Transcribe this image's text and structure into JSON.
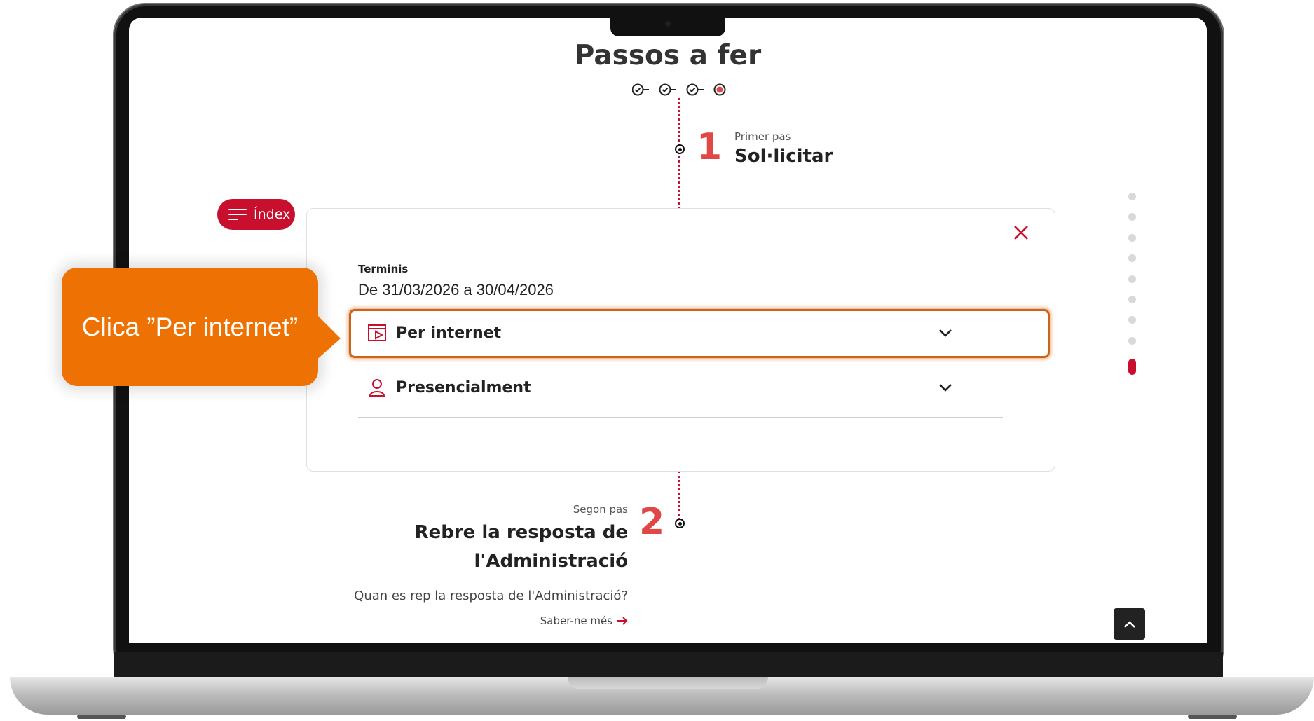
{
  "page": {
    "title": "Passos a fer",
    "steps_progress": [
      "done",
      "done",
      "done",
      "current"
    ]
  },
  "index_button": {
    "label": "Índex",
    "icon": "menu-icon"
  },
  "timeline": {
    "step1": {
      "number": "1",
      "subtitle": "Primer pas",
      "title": "Sol·licitar"
    },
    "step2": {
      "number": "2",
      "subtitle": "Segon pas",
      "title_line1": "Rebre la resposta de",
      "title_line2": "l'Administració",
      "question": "Quan es rep la resposta de l'Administració?",
      "more_link": "Saber-ne més"
    }
  },
  "card": {
    "terminis_label": "Terminis",
    "terminis_value": "De 31/03/2026 a 30/04/2026",
    "accordion": [
      {
        "label": "Per internet",
        "icon": "web-form-icon",
        "highlighted": true
      },
      {
        "label": "Presencialment",
        "icon": "person-icon",
        "highlighted": false
      }
    ]
  },
  "side_nav": {
    "dot_count": 9,
    "active_index": 8
  },
  "callout": {
    "text": "Clica ”Per internet”"
  },
  "colors": {
    "brand_red": "#c8102e",
    "step_number": "#e04848",
    "callout_orange": "#ee7203"
  }
}
